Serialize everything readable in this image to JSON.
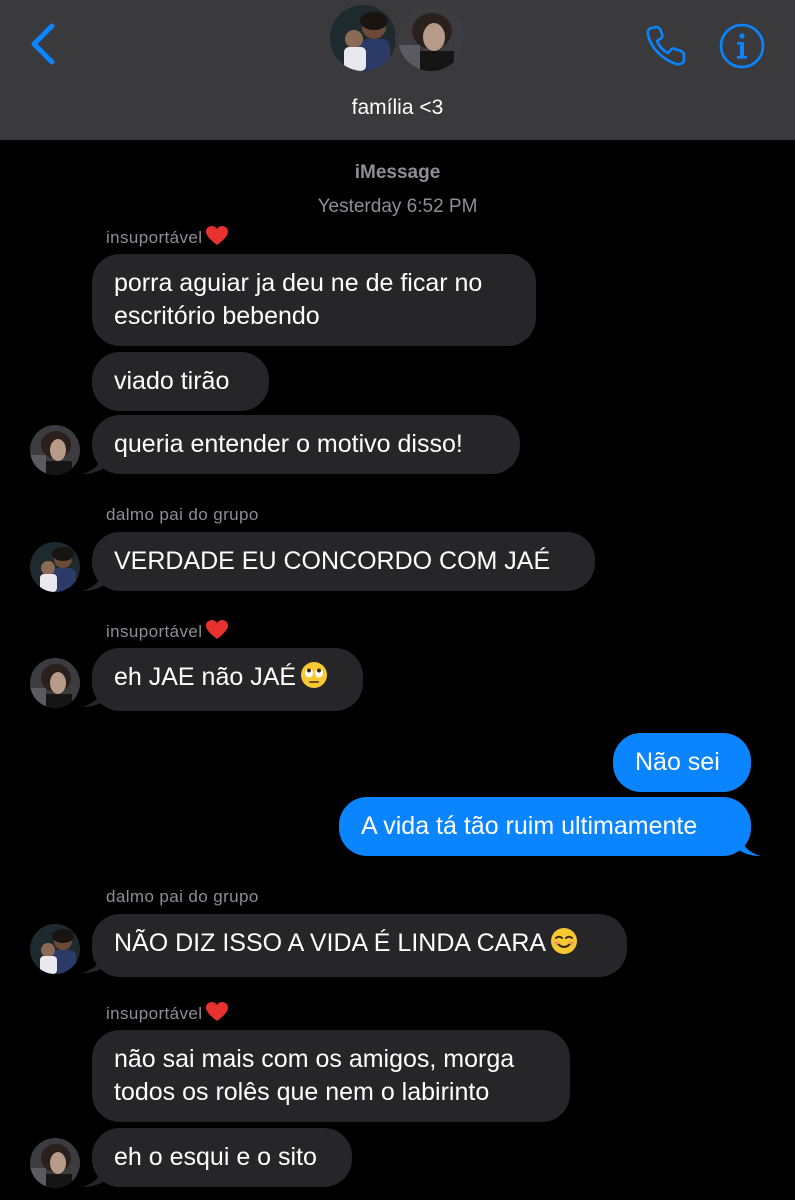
{
  "header": {
    "title": "família <3",
    "back_icon": "chevron-left-icon",
    "call_icon": "phone-icon",
    "info_icon": "info-icon",
    "accent_color": "#0a84ff"
  },
  "conversation": {
    "service": "iMessage",
    "timestamp": "Yesterday 6:52 PM"
  },
  "senders": {
    "insuportavel": "insuportável",
    "dalmo": "dalmo pai do grupo"
  },
  "messages": {
    "m1_line1": "porra aguiar ja deu ne de ficar no",
    "m1_line2": "escritório bebendo",
    "m2": "viado tirão",
    "m3": "queria entender o motivo disso!",
    "m4": "VERDADE EU CONCORDO COM JAÉ",
    "m5": "eh JAE não JAÉ",
    "m6": "Não sei",
    "m7": "A vida tá tão ruim ultimamente",
    "m8": "NÃO DIZ ISSO A VIDA É LINDA CARA",
    "m9_line1": "não sai mais com os amigos, morga",
    "m9_line2": "todos os rolês que nem o labirinto",
    "m10": "eh o esqui e o sito"
  },
  "colors": {
    "incoming_bubble": "#262628",
    "outgoing_bubble": "#0a84ff",
    "header_bg": "#3a3a3c",
    "meta_text": "#8e8e93"
  }
}
